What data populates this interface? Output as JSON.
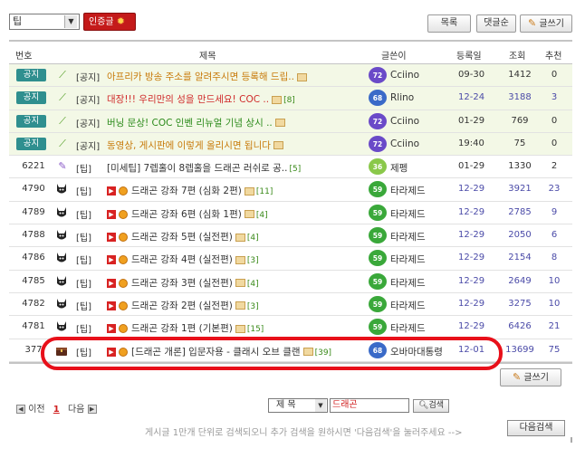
{
  "toolbar": {
    "category_value": "팁",
    "cert_label": "인증글",
    "list_label": "목록",
    "comments_label": "댓글순",
    "write_label": "글쓰기"
  },
  "header": {
    "num": "번호",
    "title": "제목",
    "author": "글쓴이",
    "date": "등록일",
    "views": "조회",
    "recs": "추천"
  },
  "notices": [
    {
      "badge": "공지",
      "cat": "[공지]",
      "title": "아프리카 방송 주소를 알려주시면 등록해 드립..",
      "comments": "",
      "lvl": "72",
      "author": "Cciino",
      "date": "09-30",
      "views": "1412",
      "recs": "0"
    },
    {
      "badge": "공지",
      "cat": "[공지]",
      "title": "대장!!! 우리만의 성을 만드세요! COC ..",
      "comments": "[8]",
      "lvl": "68",
      "author": "Rlino",
      "date": "12-24",
      "views": "3188",
      "recs": "3"
    },
    {
      "badge": "공지",
      "cat": "[공지]",
      "title": "버닝 문상! COC 인벤 리뉴얼 기념 상시 ..",
      "comments": "",
      "lvl": "72",
      "author": "Cciino",
      "date": "01-29",
      "views": "769",
      "recs": "0"
    },
    {
      "badge": "공지",
      "cat": "[공지]",
      "title": "동영상, 게시판에 이렇게 올리시면 됩니다",
      "comments": "",
      "lvl": "72",
      "author": "Cciino",
      "date": "19:40",
      "views": "75",
      "recs": "0"
    }
  ],
  "posts": [
    {
      "num": "6221",
      "cat": "[팁]",
      "title": "[미세팁] 7렙홀이 8렙홀을 드래곤 러쉬로 공..",
      "comments": "[5]",
      "lvl": "36",
      "author": "제펭",
      "date": "01-29",
      "views": "1330",
      "recs": "2"
    },
    {
      "num": "4790",
      "cat": "[팁]",
      "title": "드래곤 강좌 7편 (심화 2편)",
      "comments": "[11]",
      "lvl": "59",
      "author": "타라제드",
      "date": "12-29",
      "views": "3921",
      "recs": "23"
    },
    {
      "num": "4789",
      "cat": "[팁]",
      "title": "드래곤 강좌 6편 (심화 1편)",
      "comments": "[4]",
      "lvl": "59",
      "author": "타라제드",
      "date": "12-29",
      "views": "2785",
      "recs": "9"
    },
    {
      "num": "4788",
      "cat": "[팁]",
      "title": "드래곤 강좌 5편 (실전편)",
      "comments": "[4]",
      "lvl": "59",
      "author": "타라제드",
      "date": "12-29",
      "views": "2050",
      "recs": "6"
    },
    {
      "num": "4786",
      "cat": "[팁]",
      "title": "드래곤 강좌 4편 (실전편)",
      "comments": "[3]",
      "lvl": "59",
      "author": "타라제드",
      "date": "12-29",
      "views": "2154",
      "recs": "8"
    },
    {
      "num": "4785",
      "cat": "[팁]",
      "title": "드래곤 강좌 3편 (실전편)",
      "comments": "[4]",
      "lvl": "59",
      "author": "타라제드",
      "date": "12-29",
      "views": "2649",
      "recs": "10"
    },
    {
      "num": "4782",
      "cat": "[팁]",
      "title": "드래곤 강좌 2편 (실전편)",
      "comments": "[3]",
      "lvl": "59",
      "author": "타라제드",
      "date": "12-29",
      "views": "3275",
      "recs": "10"
    },
    {
      "num": "4781",
      "cat": "[팁]",
      "title": "드래곤 강좌 1편 (기본편)",
      "comments": "[15]",
      "lvl": "59",
      "author": "타라제드",
      "date": "12-29",
      "views": "6426",
      "recs": "21"
    },
    {
      "num": "377",
      "cat": "[팁]",
      "title": "[드래곤 개론] 입문자용 - 클래시 오브 클랜",
      "comments": "[39]",
      "lvl": "68",
      "author": "오바마대통령",
      "date": "12-01",
      "views": "13699",
      "recs": "75"
    }
  ],
  "footer": {
    "write_label": "글쓰기",
    "prev_label": "이전",
    "current_page": "1",
    "next_label": "다음",
    "search_field": "제 목",
    "search_value": "드래곤",
    "search_button": "검색",
    "help_text": "게시글 1만개 단위로 검색되오니 추가 검색을 원하시면 '다음검색'을 눌러주세요 -->",
    "next_search_label": "다음검색"
  },
  "colors": {
    "notice_bg": "#f3f8e6",
    "notice_badge": "#2f8f8f",
    "cert_button": "#c41a1a",
    "highlight_stroke": "#e8101a",
    "link_blue": "#4b4ba8"
  }
}
